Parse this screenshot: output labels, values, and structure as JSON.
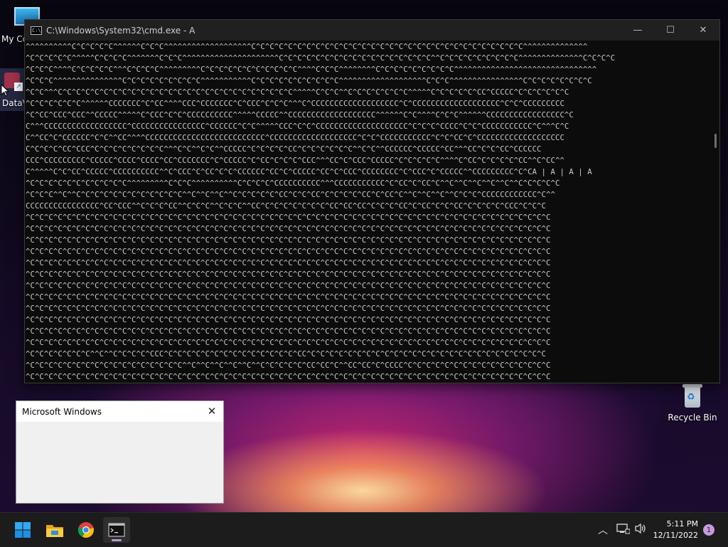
{
  "desktop": {
    "icons": [
      {
        "label": "My Co"
      },
      {
        "label": "DataV"
      },
      {
        "label": "Recycle Bin"
      }
    ]
  },
  "cmd_window": {
    "title": "C:\\Windows\\System32\\cmd.exe - A",
    "appicon_text": "C:\\",
    "buttons": {
      "minimize": "—",
      "maximize": "☐",
      "close": "✕"
    },
    "lines": [
      "^^^^^^^^^^C^C^C^C^C^^^^^^C^C^C^^^^^^^^^^^^^^^^^^^C^C^C^C^C^C^C^C^C^C^C^C^C^C^C^C^C^C^C^C^C^C^C^C^C^C^C^C^C^C^^^^^^^^^^^^^^",
      "^C^C^C^C^C^^^^^C^C^C^C^^^^^^^C^C^C^^^^^^^^^^^^^^^^^^^^^C^C^C^C^C^C^C^C^C^C^C^C^C^C^C^C^C^^C^C^C^C^C^C^C^C^C^^^^^^^^^^^^^^C^C^C^C",
      "^C^C^C^^^^C^C^C^C^C^^^C^C^C^C^^^^^^^^^C^C^C^C^C^C^C^C^C^C^C^^^^C^C^C^^^^^^^^C^C^C^C^C^C^C^C^C^^^^^^^^^^^^^^^^^^^^^^^^^^^^^^^",
      "^C^C^C^^^^^^^^^^^^^^^C^C^C^C^C^C^C^C^C^^^^^^^^^^^C^C^C^C^C^C^C^C^C^C^^^^^^^^^^^^^^^^^^^C^C^C^^^^^^^^^^^^^^^^C^C^C^C^C^C^C^C",
      "^C^C^^^C^C^C^C^C^C^C^C^C^C^C^C^C^C^C^C^C^C^C^C^C^C^C^C^C^C^^^^^C^C^C^^C^C^C^C^C^C^C^^^^^C^C^C^C^C^CC^CCCCC^C^C^C^C^C^C",
      "^C^C^C^C^C^C^^^^^^CCCCCCC^C^CC^^^^CCC^CCCCCCC^C^CCC^C^C^C^^^C^CCCCCCCCCCCCCCCCCCC^C^CCCCCCCCCCCCCCCCCCC^C^C^CCCCCCCCC",
      "^C^CC^CCC^CCC^^CCCCC^^^^^C^CCC^C^C^CCCCCCCCCC^^^^^CCCCC^^CCCCCCCCCCCCCCCCCCC^^^^^^C^C^^^^C^C^C^^^^^^CCCCCCCCCCCCCCCCC^C",
      "C^^^CCCCCCCCCCCCCCCCCC^CCCCCCCCCCCCCCCC^CCCCCC^C^C^^^^^CCC^C^C^CCCCCCCCCCCCCCCCCCCC^C^C^C^CCCC^C^C^CCCCCCCCCCC^C^^^C^C",
      "C^^CC^C^CCCCCC^C^C^^CC^^^^CCCCCCCCCCCCCCCCCCCCCCCCCC^CCCCCCCCCCCCCCCCCCC^C^C^CCCCCCCCCCC^C^C^CC^C^CCCCCCCCCCCCCCCCCCC",
      "C^C^C^C^CC^CCC^C^C^C^C^C^C^C^C^^^C^C^^C^C^^CCCCC^C^C^C^C^CC^C^C^C^C^C^C^^C^C^^CCCCCC^CCCCC^CC^^^CC^C^C^CC^CCCCCC",
      "CCC^CCCCCCCCC^CCCCC^CCCC^CCCC^CC^CCCCCCC^C^CCCCC^C^CC^C^C^C^CCC^^^CC^C^CCC^CCCCC^C^C^C^C^C^^^^C^CC^C^C^C^C^CC^^C^CC^^",
      "C^^^^^C^C^CC^CCCCC^CCCCCCCCCC^^C^CCC^C^CC^C^C^CCCCCC^CC^C^CCCCC^CC^C^CCC^CCCCCCCC^C^CCC^C^CCCCC^^CCCCCCCCC^C^CA | A | A | A",
      "^C^C^C^C^C^C^C^C^C^C^C^^^^^^^^^C^C^C^^^^^^^^^^C^C^C^C^CCCCCCCCCC^^^CCCCCCCCCCC^C^CC^C^CC^C^^C^^C^^C^^C^^C^^C^C^C^C^C",
      "^C^C^C^^C^^C^C^C^C^C^C^C^C^C^C^C^C^^C^^C^^C^^C^C^C^C^C^CC^C^C^CC^C^C^C^C^CC^C^CC^C^^C^^C^^C^^C^C^C^CCCCCCCCCCCC^C^^",
      "CCCCCCCCCCCCCCCC^CC^CCC^^C^C^C^CC^^C^C^C^^C^C^C^^CC^C^C^C^C^C^C^C^CC^CC^CC^C^C^C^CC^C^CC^C^C^CC^C^C^C^C^CCC^C^C^C",
      "^C^C^C^C^C^C^C^C^C^C^C^C^C^C^C^C^C^C^C^C^C^C^C^C^C^C^C^C^C^C^C^C^C^C^C^C^C^C^C^C^C^C^C^C^C^C^C^C^C^C^C^C^C^C^C^C^C",
      "^C^C^C^C^C^C^C^C^C^C^C^C^C^C^C^C^C^C^C^C^C^C^C^C^C^C^C^C^C^C^C^C^C^C^C^C^C^C^C^C^C^C^C^C^C^C^C^C^C^C^C^C^C^C^C^C^C",
      "^C^C^C^C^C^C^C^C^C^C^C^C^C^C^C^C^C^C^C^C^C^C^C^C^C^C^C^C^C^C^C^C^C^C^C^C^C^C^C^C^C^C^C^C^C^C^C^C^C^C^C^C^C^C^C^C^C",
      "^C^C^C^C^C^C^C^C^C^C^C^C^C^C^C^C^C^C^C^C^C^C^C^C^C^C^C^C^C^C^C^C^C^C^C^C^C^C^C^C^C^C^C^C^C^C^C^C^C^C^C^C^C^C^C^C^C",
      "^C^C^C^C^C^C^C^C^C^C^C^C^C^C^C^C^C^C^C^C^C^C^C^C^C^C^C^C^C^C^C^C^C^C^C^C^C^C^C^C^C^C^C^C^C^C^C^C^C^C^C^C^C^C^C^C^C",
      "^C^C^C^C^C^C^C^C^C^C^C^C^C^C^C^C^C^C^C^C^C^C^C^C^C^C^C^C^C^C^C^C^C^C^C^C^C^C^C^C^C^C^C^C^C^C^C^C^C^C^C^C^C^C^C^C^C",
      "^C^C^C^C^C^C^C^C^C^C^C^C^C^C^C^C^C^C^C^C^C^C^C^C^C^C^C^C^C^C^C^C^C^C^C^C^C^C^C^C^C^C^C^C^C^C^C^C^C^C^C^C^C^C^C^C^C",
      "^C^C^C^C^C^C^C^C^C^C^C^C^C^C^C^C^C^C^C^C^C^C^C^C^C^C^C^C^C^C^C^C^C^C^C^C^C^C^C^C^C^C^C^C^C^C^C^C^C^C^C^C^C^C^C^C^C",
      "^C^C^C^C^C^C^C^C^C^C^C^C^C^C^C^C^C^C^C^C^C^C^C^C^C^C^C^C^C^C^C^C^C^C^C^C^C^C^C^C^C^C^C^C^C^C^C^C^C^C^C^C^C^C^C^C^C",
      "^C^C^C^C^C^C^C^C^C^C^C^C^C^C^C^C^C^C^C^C^C^C^C^C^C^C^C^C^C^C^C^C^C^C^C^C^C^C^C^C^C^C^C^C^C^C^C^C^C^C^C^C^C^C^C^C^C",
      "^C^C^C^C^C^C^C^C^C^C^C^C^C^C^C^C^C^C^C^C^C^C^C^C^C^C^C^C^C^C^C^C^C^C^C^C^C^C^C^C^C^C^C^C^C^C^C^C^C^C^C^C^C^C^C^C^C",
      "^C^C^C^C^C^C^C^C^C^C^C^C^C^C^C^C^C^C^C^C^C^C^C^C^C^C^C^C^C^C^C^C^C^C^C^C^C^C^C^C^C^C^C^C^C^C^C^C^C^C^C^C^C^C^C^C^C",
      "^C^C^C^C^C^C^C^^C^^C^C^C^C^CCC^C^C^C^C^C^C^C^C^C^C^C^C^C^C^CC^C^C^C^C^C^C^C^C^C^C^C^C^C^C^C^C^C^C^C^C^C^C^C^C^C^C",
      "^C^C^C^C^C^C^C^C^C^C^C^C^C^C^C^C^C^^C^^C^^C^^C^^C^^C^C^C^C^C^CC^CC^C^^CC^CC^C^CCCC^C^C^C^C^C^C^C^C^C^C^C^C^C^C^C^C",
      "^C^C^C^C^C^C^C^C^C^C^C^C^C^C^C^C^C^C^C^C^C^C^C^C^C^C^C^C^C^C^C^C^C^C^C^C^C^C^C^C^C^C^C^C^C^C^C^C^C^C^C^C^C^C^C^C^C"
    ],
    "last_line": "^C^C^C^C^C^C^C^C^C^C^C^C^C^C^C^C^C^C"
  },
  "dialog": {
    "title": "Microsoft Windows",
    "close": "✕"
  },
  "taskbar": {
    "time": "5:11 PM",
    "date": "12/11/2022",
    "notification_count": "1",
    "tray_chevron": "︿",
    "items": [
      {
        "icon": "windows-start-icon"
      },
      {
        "icon": "file-explorer-icon"
      },
      {
        "icon": "chrome-icon"
      },
      {
        "icon": "terminal-icon"
      }
    ]
  },
  "colors": {
    "console_bg": "#0c0c0c",
    "console_text": "#cccccc",
    "taskbar_bg": "#1c1c1c",
    "accent": "#b99ad6"
  }
}
